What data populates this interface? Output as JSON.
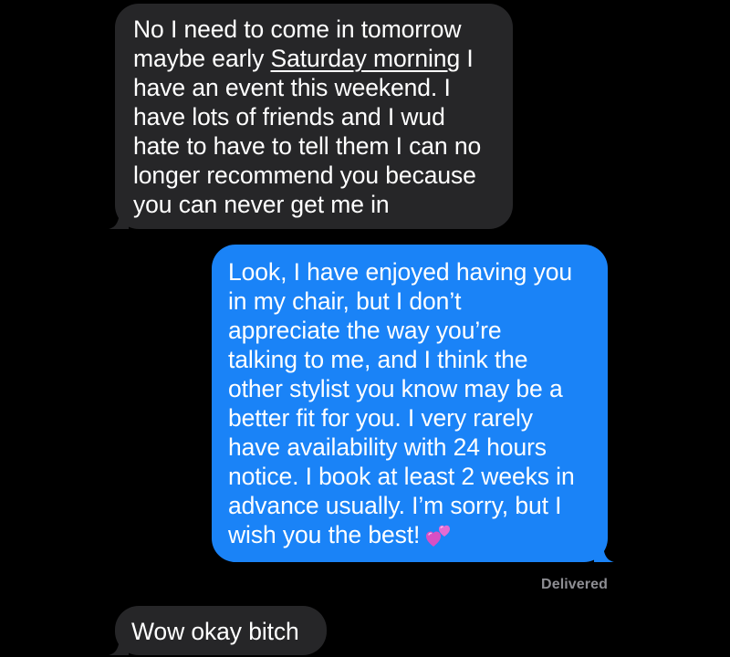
{
  "messages": [
    {
      "id": "msg1",
      "direction": "received",
      "lines": [
        "No I need to come in tomorrow",
        "maybe early ",
        "Saturday morning",
        " I",
        "have an event this weekend. I",
        "have lots of friends and I wud",
        "hate to have to tell them I can no",
        "longer recommend you because",
        "you can never get me in"
      ]
    },
    {
      "id": "msg2",
      "direction": "sent",
      "lines": [
        "Look, I have enjoyed having you",
        "in my chair, but I don’t",
        "appreciate the way you’re",
        "talking to me, and I think the",
        "other stylist you know may be a",
        "better fit for you. I very rarely",
        "have availability with 24 hours",
        "notice. I book at least 2 weeks in",
        "advance usually. I’m sorry, but I",
        "wish you the best!"
      ],
      "emoji": "two-hearts-emoji"
    },
    {
      "id": "msg3",
      "direction": "received",
      "lines": [
        "Wow okay bitch"
      ]
    }
  ],
  "status": {
    "delivered": "Delivered"
  },
  "colors": {
    "background": "#000000",
    "received_bubble": "#262628",
    "sent_bubble": "#1a83f7",
    "text": "#ffffff",
    "status_text": "#8e8e93"
  }
}
